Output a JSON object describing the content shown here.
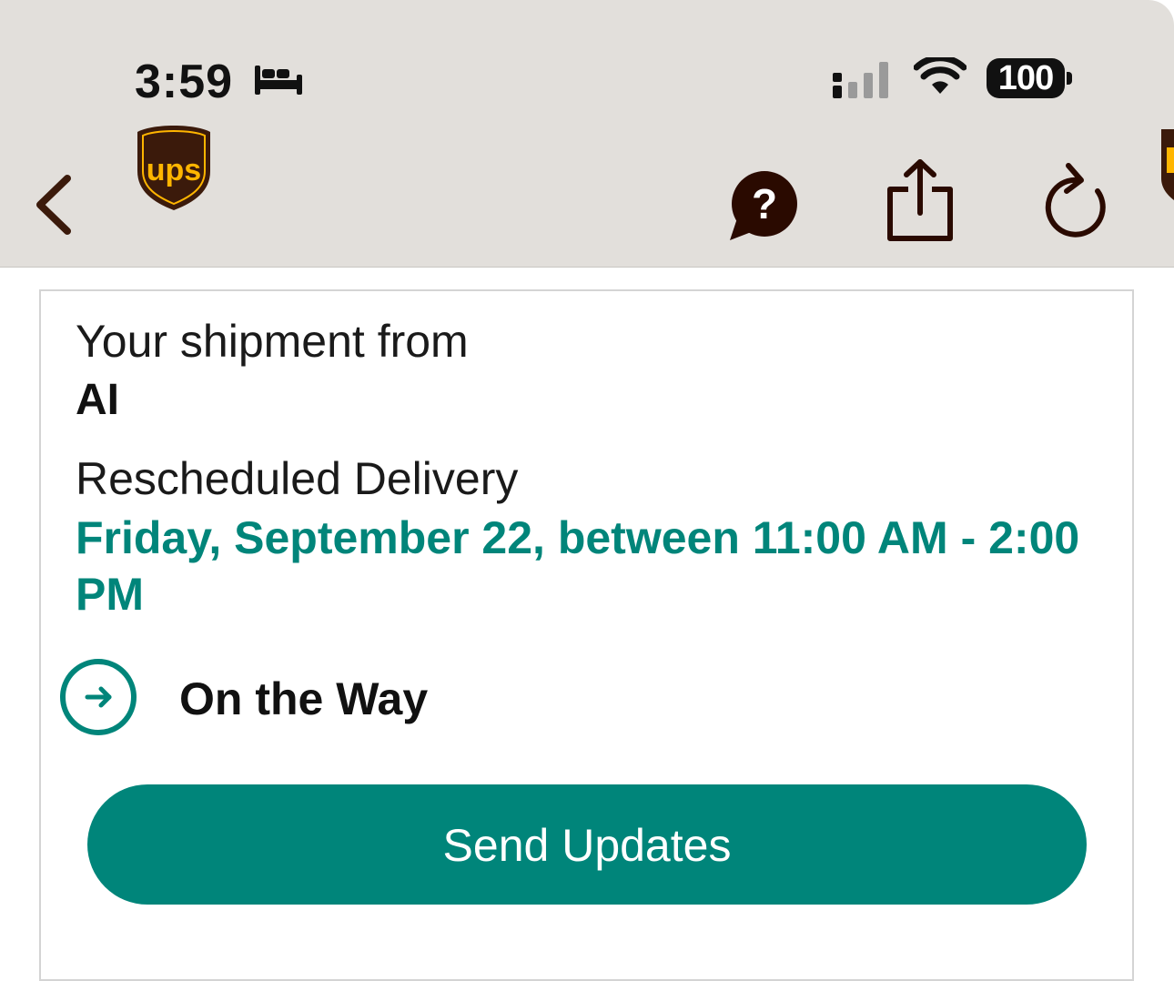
{
  "status_bar": {
    "time": "3:59",
    "battery": "100"
  },
  "nav": {
    "back_icon": "chevron-left-icon",
    "logo_text": "ups",
    "help_icon": "question-bubble-icon",
    "share_icon": "share-icon",
    "refresh_icon": "refresh-icon"
  },
  "shipment": {
    "from_label": "Your shipment from",
    "sender": "AI",
    "delivery_label": "Rescheduled Delivery",
    "delivery_window": "Friday, September 22, between 11:00 AM - 2:00 PM",
    "status": "On the Way"
  },
  "actions": {
    "send_updates": "Send Updates"
  },
  "colors": {
    "accent": "#00857a",
    "brand_brown": "#3b1a0b",
    "brand_gold": "#ffb500",
    "toolbar_bg": "#e2dfdb"
  }
}
